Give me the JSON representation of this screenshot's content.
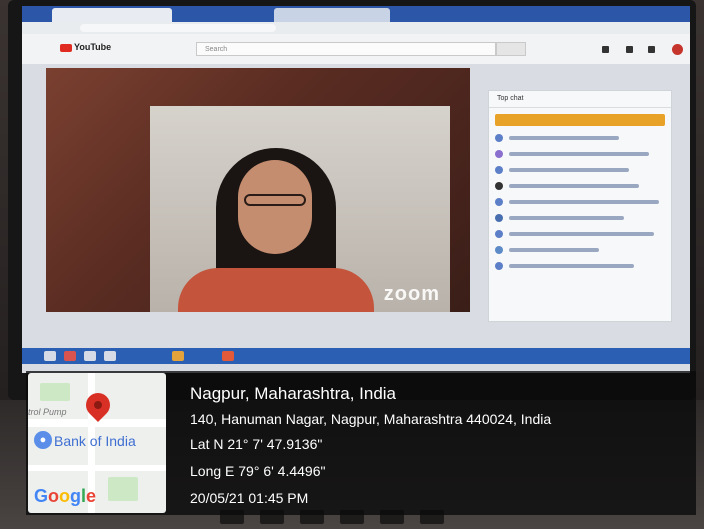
{
  "location": {
    "city": "Nagpur, Maharashtra, India",
    "address": "140, Hanuman Nagar, Nagpur, Maharashtra 440024, India",
    "latitude": "Lat N 21° 7' 47.9136\"",
    "longitude": "Long E 79° 6' 4.4496\"",
    "timestamp": "20/05/21 01:45 PM"
  },
  "map": {
    "poi_label": "Bank of India",
    "road_label": "trol Pump",
    "provider": [
      "G",
      "o",
      "o",
      "g",
      "l",
      "e"
    ]
  },
  "screen": {
    "site_name": "YouTube",
    "search_placeholder": "Search",
    "chat_header": "Top chat",
    "video_watermark": "zoom"
  }
}
